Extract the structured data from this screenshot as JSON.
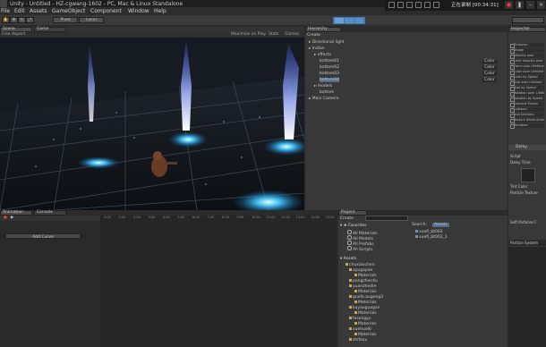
{
  "window": {
    "title": "Unity - Untitled - HZ-cgwang-1602 - PC, Mac & Linux Standalone"
  },
  "recorder": {
    "status": "正在录制 [00:34:31]"
  },
  "menu": [
    "File",
    "Edit",
    "Assets",
    "GameObject",
    "Component",
    "Window",
    "Help"
  ],
  "toolbar": {
    "pivot": "Pivot",
    "local": "Local"
  },
  "scene": {
    "tabs": [
      "Scene",
      "Game"
    ],
    "shading": "Free Aspect",
    "maximize": "Maximize on Play",
    "stats": "Stats",
    "gizmos": "Gizmos"
  },
  "hierarchy": {
    "tab": "Hierarchy",
    "create": "Create",
    "items": [
      {
        "label": "Directional light",
        "indent": 0
      },
      {
        "label": "Indian",
        "indent": 0
      },
      {
        "label": "effects",
        "indent": 1
      },
      {
        "label": "bottom01",
        "indent": 2
      },
      {
        "label": "bottom02",
        "indent": 2
      },
      {
        "label": "bottom03",
        "indent": 2
      },
      {
        "label": "bottom04",
        "indent": 2
      },
      {
        "label": "models",
        "indent": 1
      },
      {
        "label": "bottom",
        "indent": 2
      },
      {
        "label": "Main Camera",
        "indent": 0
      }
    ],
    "toggles": [
      "Color",
      "Color",
      "Color",
      "Color"
    ]
  },
  "inspector": {
    "tab": "Inspector",
    "rows": [
      "Emission",
      "Shape",
      "Velocity over",
      "Limit Velocity over",
      "Force over Lifetime",
      "Color over Lifetime",
      "Color by Speed",
      "Size over Lifetime",
      "Size by Speed",
      "Rotation over Lifetime",
      "Rotation by Speed",
      "External Forces",
      "Collision",
      "Sub Emitters",
      "Texture Sheet Anim",
      "Renderer"
    ],
    "particle_title": "Delay",
    "labels": [
      "Script",
      "Delay Time",
      "Tint Color",
      "Particle Texture",
      "Soft Particles F",
      "Particle System"
    ]
  },
  "animation": {
    "tabs": [
      "Animation",
      "Console"
    ],
    "add_curve": "Add Curve",
    "ruler": [
      "0:00",
      "1:00",
      "2:00",
      "3:00",
      "4:00",
      "5:00",
      "6:00",
      "7:00",
      "8:00",
      "9:00",
      "10:00",
      "11:00",
      "12:00",
      "13:00",
      "14:00",
      "15:00"
    ]
  },
  "project": {
    "tab": "Project",
    "create": "Create",
    "search_label": "Search:",
    "search_scope": "Assets",
    "favorites_header": "Favorites",
    "favorites": [
      "All Materials",
      "All Models",
      "All Prefabs",
      "All Scripts"
    ],
    "assets_header": "Assets",
    "folders": [
      "chuxiaochen",
      "ayugapoe",
      "Materials",
      "pongzhen4u",
      "yuanzhedre",
      "Materials",
      "guefa.augong3",
      "Materials",
      "kuyauguagon",
      "Materials",
      "fasongyu",
      "Materials",
      "xuehuel6",
      "Materials",
      "zhifaxu"
    ],
    "search_results": [
      "xuefi_bt002",
      "xuefi_bt002_1"
    ]
  }
}
